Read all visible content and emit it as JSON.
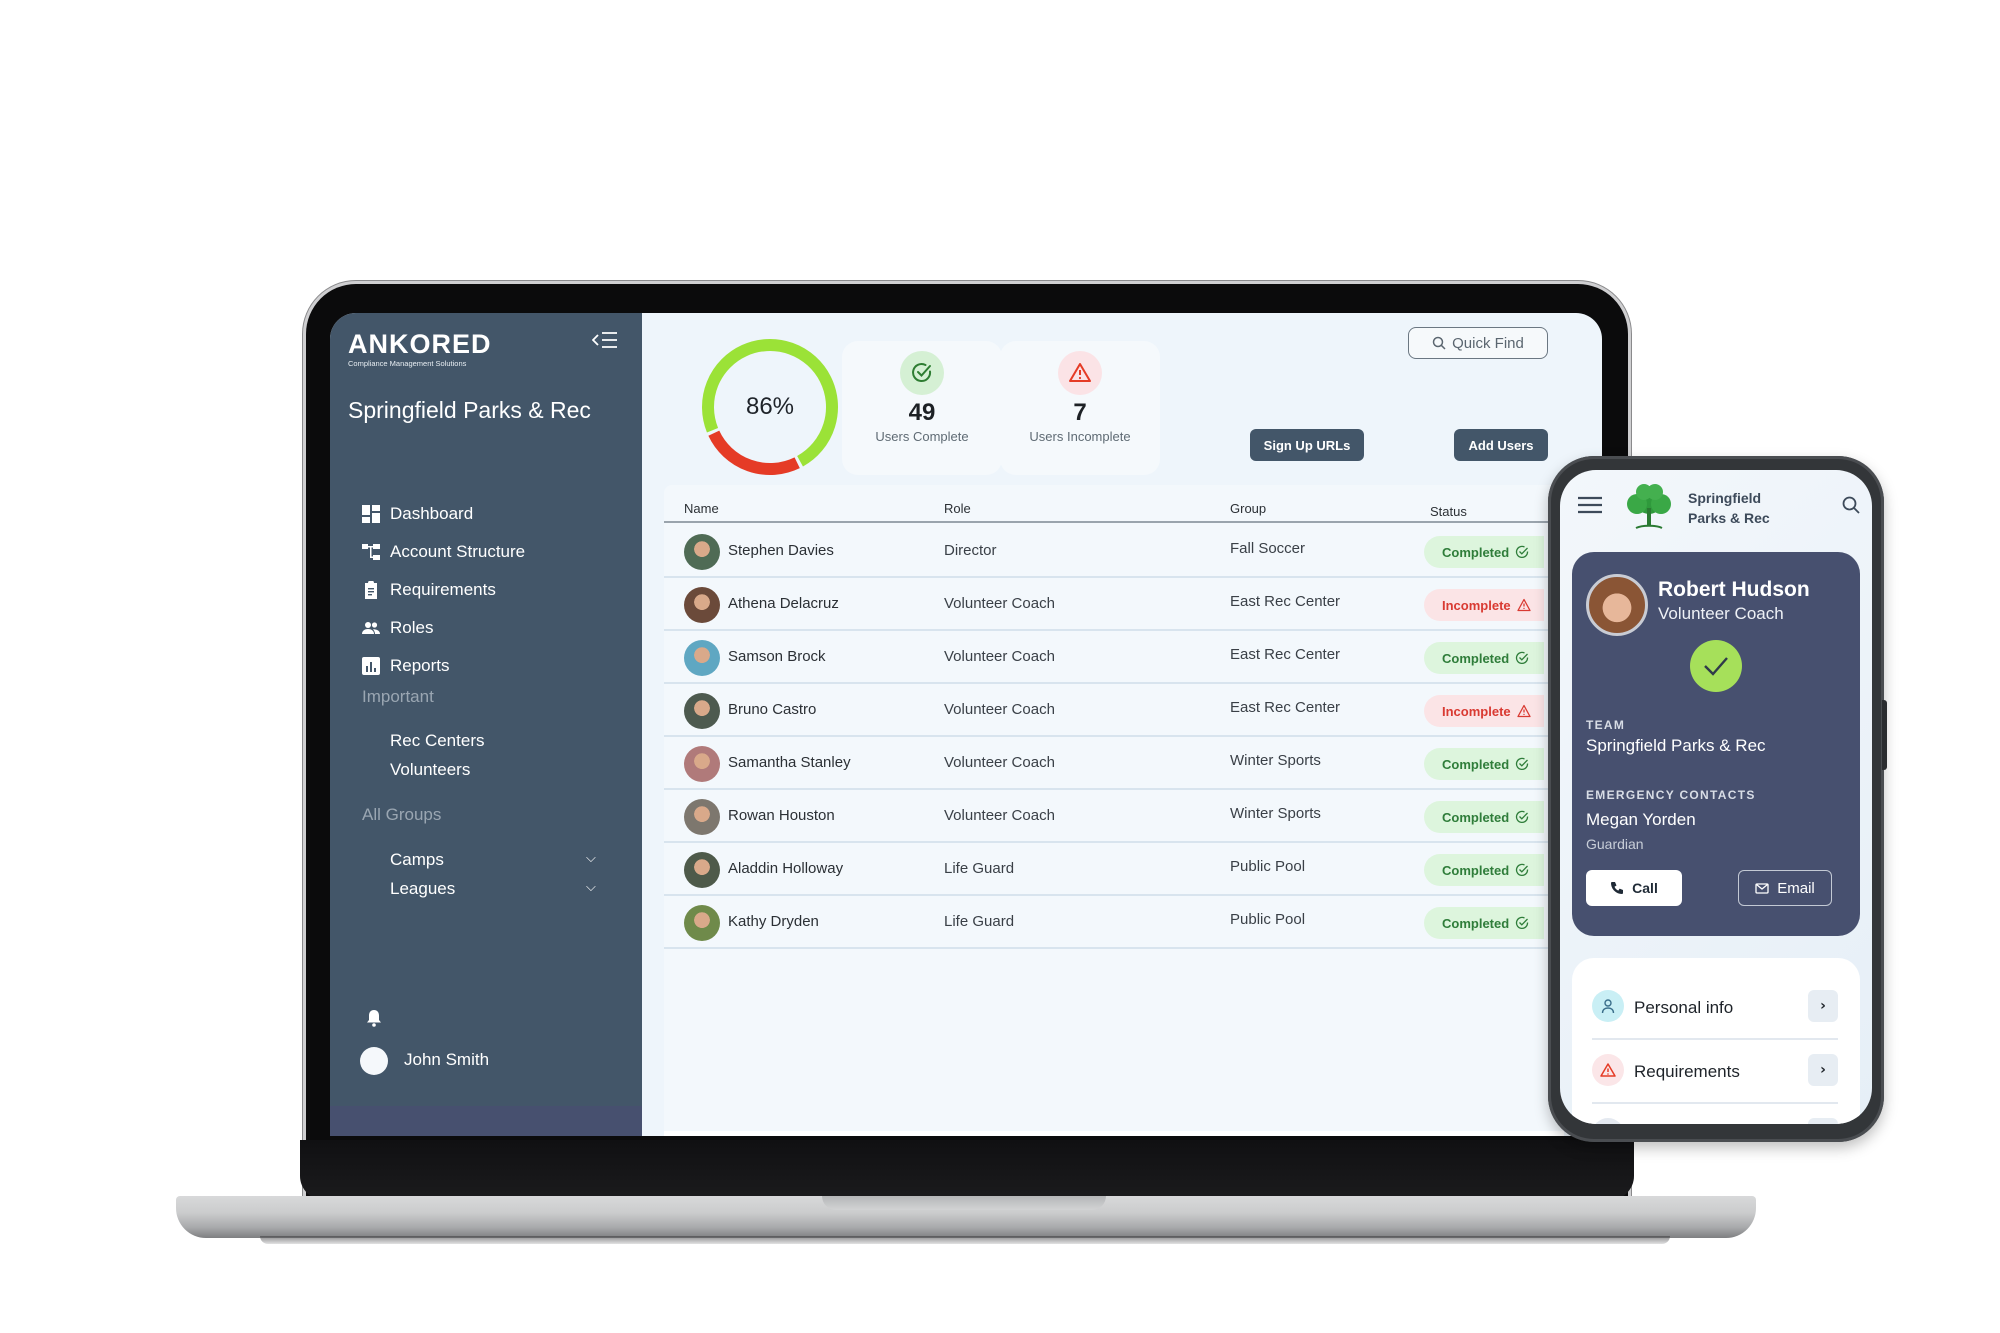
{
  "brand": {
    "name": "ANKORED",
    "tagline": "Compliance Management Solutions"
  },
  "sidebar": {
    "org_title": "Springfield Parks & Rec",
    "collapse_icon": "collapse-menu-icon",
    "nav_items": [
      {
        "label": "Dashboard",
        "icon": "dashboard-icon"
      },
      {
        "label": "Account Structure",
        "icon": "account-structure-icon"
      },
      {
        "label": "Requirements",
        "icon": "clipboard-icon"
      },
      {
        "label": "Roles",
        "icon": "people-icon"
      },
      {
        "label": "Reports",
        "icon": "bar-chart-icon"
      }
    ],
    "important_label": "Important",
    "important_items": [
      "Rec Centers",
      "Volunteers"
    ],
    "all_groups_label": "All Groups",
    "group_items": [
      {
        "label": "Camps",
        "expandable": true
      },
      {
        "label": "Leagues",
        "expandable": true
      }
    ],
    "user_name": "John Smith"
  },
  "summary": {
    "completion_percent": 86,
    "completion_label": "86%",
    "colors": {
      "complete": "#9be237",
      "incomplete": "#e53b26"
    },
    "users_complete": {
      "value": "49",
      "label": "Users Complete"
    },
    "users_incomplete": {
      "value": "7",
      "label": "Users Incomplete"
    }
  },
  "toolbar": {
    "quick_find_placeholder": "Quick Find",
    "sign_up_urls_label": "Sign Up URLs",
    "add_users_label": "Add Users"
  },
  "table": {
    "columns": [
      "Name",
      "Role",
      "Group",
      "Status"
    ],
    "rows": [
      {
        "name": "Stephen Davies",
        "role": "Director",
        "group": "Fall Soccer",
        "status": "Completed",
        "status_type": "complete"
      },
      {
        "name": "Athena Delacruz",
        "role": "Volunteer Coach",
        "group": "East Rec Center",
        "status": "Incomplete",
        "status_type": "incomplete"
      },
      {
        "name": "Samson Brock",
        "role": "Volunteer Coach",
        "group": "East Rec Center",
        "status": "Completed",
        "status_type": "complete"
      },
      {
        "name": "Bruno Castro",
        "role": "Volunteer Coach",
        "group": "East Rec Center",
        "status": "Incomplete",
        "status_type": "incomplete"
      },
      {
        "name": "Samantha Stanley",
        "role": "Volunteer Coach",
        "group": "Winter Sports",
        "status": "Completed",
        "status_type": "complete"
      },
      {
        "name": "Rowan Houston",
        "role": "Volunteer Coach",
        "group": "Winter Sports",
        "status": "Completed",
        "status_type": "complete"
      },
      {
        "name": "Aladdin Holloway",
        "role": "Life Guard",
        "group": "Public Pool",
        "status": "Completed",
        "status_type": "complete"
      },
      {
        "name": "Kathy Dryden",
        "role": "Life Guard",
        "group": "Public Pool",
        "status": "Completed",
        "status_type": "complete"
      }
    ]
  },
  "phone": {
    "header": {
      "org_line1": "Springfield",
      "org_line2": "Parks & Rec"
    },
    "profile": {
      "name": "Robert Hudson",
      "role": "Volunteer Coach",
      "status": "complete",
      "team_label": "TEAM",
      "team_value": "Springfield Parks & Rec",
      "emergency_label": "EMERGENCY CONTACTS",
      "contact_name": "Megan Yorden",
      "contact_relation": "Guardian",
      "call_label": "Call",
      "email_label": "Email"
    },
    "menu": [
      {
        "label": "Personal info",
        "icon": "person-icon"
      },
      {
        "label": "Requirements",
        "icon": "warning-icon"
      }
    ]
  }
}
